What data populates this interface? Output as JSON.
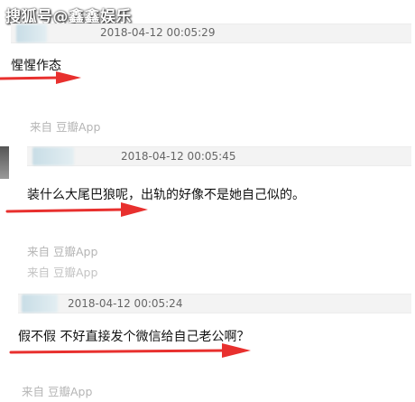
{
  "watermark": "搜狐号@鑫鑫娱乐",
  "comments": [
    {
      "timestamp": "2018-04-12 00:05:29",
      "text": "惺惺作态",
      "source": "来自 豆瓣App"
    },
    {
      "timestamp": "2018-04-12 00:05:45",
      "text": "装什么大尾巴狼呢，出轨的好像不是她自己似的。",
      "source": "来自 豆瓣App",
      "source_repeat": "来自 豆瓣App"
    },
    {
      "timestamp": "2018-04-12 00:05:24",
      "text": "假不假 不好直接发个微信给自己老公啊？",
      "source": "来自 豆瓣App"
    }
  ],
  "colors": {
    "arrow": "#e8302e",
    "meta_bg": "#f3f3f3",
    "muted": "#b5b5b5"
  },
  "icons": [
    "red-arrow-icon",
    "blurred-avatar"
  ]
}
